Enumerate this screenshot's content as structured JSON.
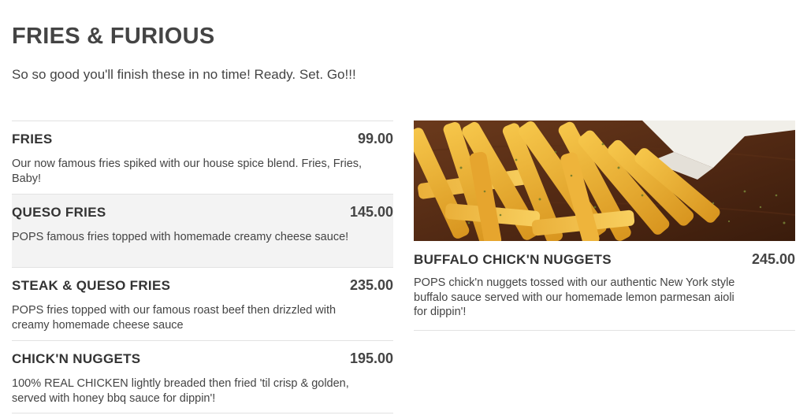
{
  "section": {
    "title": "FRIES & FURIOUS",
    "subtitle": "So so good you'll finish these in no time! Ready. Set. Go!!!"
  },
  "items": [
    {
      "name": "FRIES",
      "price": "99.00",
      "description": "Our now famous fries spiked with our house spice blend. Fries, Fries, Baby!"
    },
    {
      "name": "QUESO FRIES",
      "price": "145.00",
      "description": "POPS famous fries topped with homemade creamy cheese sauce!"
    },
    {
      "name": "STEAK & QUESO FRIES",
      "price": "235.00",
      "description": "POPS fries topped with our famous roast beef then drizzled with creamy homemade cheese sauce"
    },
    {
      "name": "CHICK'N NUGGETS",
      "price": "195.00",
      "description": "100% REAL CHICKEN lightly breaded then fried 'til crisp & golden, served with honey bbq sauce for dippin'!"
    }
  ],
  "featured": {
    "name": "BUFFALO CHICK'N NUGGETS",
    "price": "245.00",
    "description": "POPS chick'n nuggets tossed with our authentic New York style buffalo sauce served with our homemade lemon parmesan aioli for dippin'!",
    "image_icon": "fries-photo"
  },
  "colors": {
    "text": "#333333",
    "shaded_row": "#f3f3f3",
    "divider": "#e2e2e2"
  }
}
